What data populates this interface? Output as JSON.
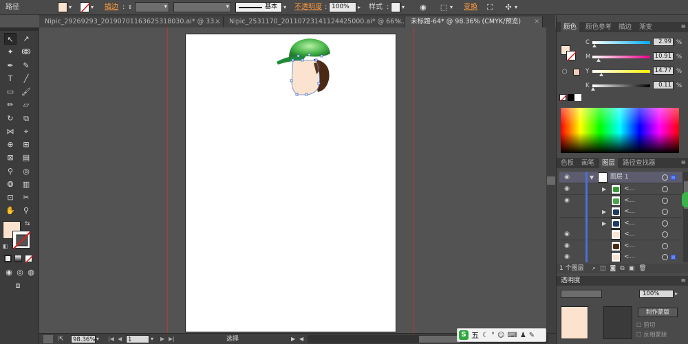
{
  "control_bar": {
    "object_type": "路径",
    "fill_color": "#fbe3cf",
    "stroke_label": "描边",
    "stroke_profile": "基本",
    "opacity_label": "不透明度",
    "opacity_value": "100%",
    "style_label": "样式",
    "transform_label": "变换"
  },
  "tabs": [
    {
      "label": "Nipic_29269293_20190701163625318030.ai* @ 33..."
    },
    {
      "label": "Nipic_2531170_20110723141124425000.ai* @ 66%..."
    },
    {
      "label": "未标题-64* @ 98.36% (CMYK/预览)"
    }
  ],
  "status": {
    "zoom": "98.36%",
    "page": "1",
    "tool": "选择"
  },
  "color_panel": {
    "tabs": [
      "颜色",
      "颜色参考",
      "描边",
      "渐变"
    ],
    "channels": [
      {
        "name": "C",
        "value": "2.99",
        "fraction": 0.03,
        "gradient": "linear-gradient(to right,#fff,#00aeef)"
      },
      {
        "name": "M",
        "value": "10.91",
        "fraction": 0.11,
        "gradient": "linear-gradient(to right,#fff,#ec008c)"
      },
      {
        "name": "Y",
        "value": "14.77",
        "fraction": 0.15,
        "gradient": "linear-gradient(to right,#fff,#fff200)"
      },
      {
        "name": "K",
        "value": "0.11",
        "fraction": 0.01,
        "gradient": "linear-gradient(to right,#fff,#000)"
      }
    ]
  },
  "layers_panel": {
    "tabs": [
      "色板",
      "画笔",
      "图层",
      "路径查找器"
    ],
    "layer_name": "图层 1",
    "item_label": "<...",
    "count_label": "1 个图层",
    "rows": [
      {
        "visible": true,
        "expandable": true,
        "thumb": "#3a9a3a"
      },
      {
        "visible": true,
        "expandable": false,
        "thumb": "#4aa64a"
      },
      {
        "visible": false,
        "expandable": true,
        "thumb": "#1f3b63"
      },
      {
        "visible": false,
        "expandable": true,
        "thumb": "#1f3b63"
      },
      {
        "visible": true,
        "expandable": false,
        "thumb": "#fbe3cf"
      },
      {
        "visible": true,
        "expandable": false,
        "thumb": "#4a2a14"
      },
      {
        "visible": true,
        "expandable": false,
        "thumb": "#fbe3cf"
      }
    ]
  },
  "transparency_panel": {
    "title": "透明度",
    "opacity": "100%",
    "make_mask": "制作蒙版",
    "clip": "剪切",
    "invert_mask": "反相蒙版"
  },
  "ime_bar": {
    "label": "五"
  }
}
